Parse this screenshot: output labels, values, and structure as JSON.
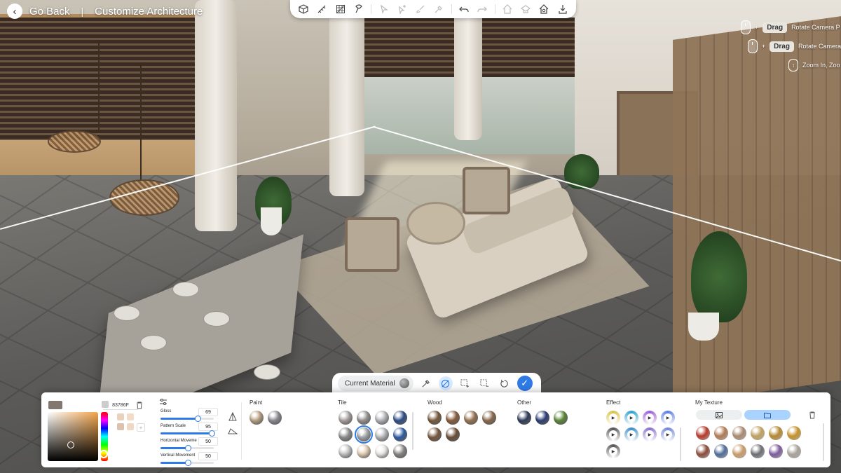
{
  "header": {
    "back_label": "Go Back",
    "separator": "|",
    "title": "Customize Architecture"
  },
  "toolbar": {
    "icons": [
      "cube-icon",
      "measure-icon",
      "grid-off-icon",
      "magnet-icon",
      "cursor-icon",
      "cursor-plus-icon",
      "brush-icon",
      "paint-pick-icon",
      "undo-icon",
      "redo-icon",
      "home-view-icon",
      "render-icon",
      "save-view-icon",
      "download-icon"
    ]
  },
  "hints": {
    "rotate_point": {
      "key": "Drag",
      "text": "Rotate Camera P"
    },
    "rotate_camera": {
      "key": "Drag",
      "text": "Rotate Camera"
    },
    "zoom": {
      "text": "Zoom In, Zoo"
    },
    "plus": "+"
  },
  "material_toolbar": {
    "current_material_label": "Current Material",
    "check_glyph": "✓"
  },
  "panel": {
    "color": {
      "hex": "83786F",
      "primary_color": "#83786f",
      "secondary_color": "#cccccc",
      "recent_colors": [
        "#e8d2bd",
        "#f2dcc8",
        "#dcc2ae",
        "#f0d9c4"
      ],
      "add_glyph": "+"
    },
    "sliders": [
      {
        "label": "Gloss",
        "value": "69",
        "fraction": 0.69
      },
      {
        "label": "Pattern Scale",
        "value": "95",
        "fraction": 0.95
      },
      {
        "label": "Horizontal Moveme",
        "value": "50",
        "fraction": 0.5
      },
      {
        "label": "Vertical Movement",
        "value": "50",
        "fraction": 0.5
      }
    ],
    "sections": {
      "paint": "Paint",
      "tile": "Tile",
      "wood": "Wood",
      "other": "Other",
      "effect": "Effect",
      "my_texture": "My Texture"
    },
    "paint_swatches": [
      "#b9a284",
      "#8c8c92"
    ],
    "tile_swatches": [
      [
        "#a9a3a0",
        "#979390",
        "#b4b6ba",
        "#2d4f8a"
      ],
      [
        "#8f8e8f",
        "#a6a8ab",
        "#b5b7ba",
        "#2f5da6"
      ],
      [
        "#c3c3c5",
        "#e3cdb3",
        "#ebe9e7",
        "#8a8784"
      ]
    ],
    "wood_swatches": [
      [
        "#7a5a3e",
        "#8a5f3d",
        "#9a7553",
        "#8c6b4e"
      ],
      [
        "#7b5a40",
        "#6c5039"
      ]
    ],
    "other_swatches": [
      "#2f3c5a",
      "#2c3f78",
      "#5e8a3b"
    ],
    "effect_swatches": [
      [
        "#d9c247",
        "#2aa3c9",
        "#9d5bd8",
        "#5b7be6"
      ],
      [
        "#555555",
        "#3e8fc6",
        "#8a6fd0",
        "#6f87d8"
      ],
      [
        "#555555"
      ]
    ],
    "my_texture_swatches": [
      [
        "#b73a2a",
        "#b07a55",
        "#a98a70",
        "#c0a060",
        "#b48830",
        "#c4922b"
      ],
      [
        "#8a4b3a",
        "#4e6b98",
        "#c89a6a",
        "#6b6e73",
        "#7c5a9a",
        "#a8a29a"
      ]
    ]
  }
}
